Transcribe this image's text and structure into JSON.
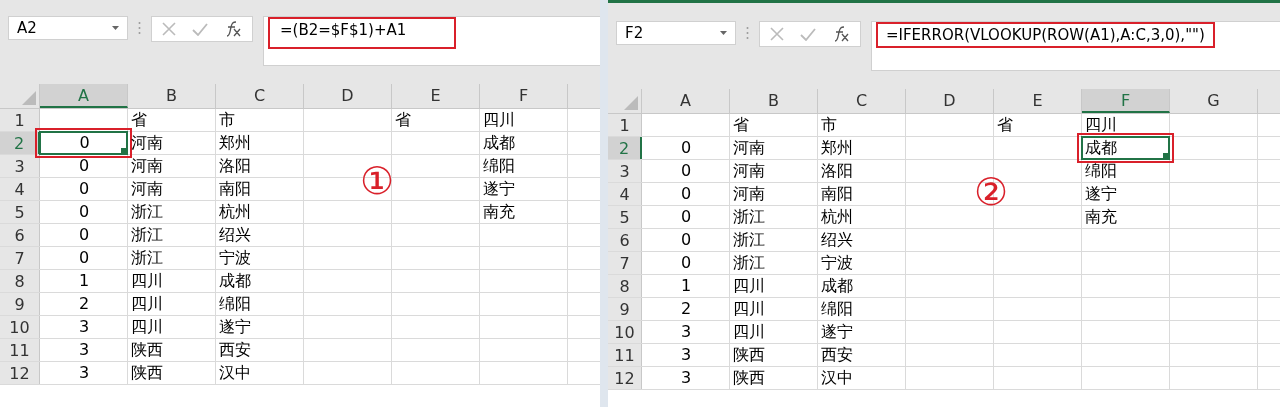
{
  "panels": [
    {
      "name_box": "A2",
      "formula": "=(B2=$F$1)+A1",
      "formula_highlighted": true,
      "cell_highlighted": true,
      "annotation": "①",
      "columns": [
        {
          "label": "A",
          "selected": true
        },
        {
          "label": "B",
          "selected": false
        },
        {
          "label": "C",
          "selected": false
        },
        {
          "label": "D",
          "selected": false
        },
        {
          "label": "E",
          "selected": false
        },
        {
          "label": "F",
          "selected": false
        }
      ],
      "rows": [
        {
          "number": "1",
          "selected": false,
          "cells": [
            "",
            "省",
            "市",
            "",
            "省",
            "四川"
          ]
        },
        {
          "number": "2",
          "selected": true,
          "cells": [
            "0",
            "河南",
            "郑州",
            "",
            "",
            "成都"
          ]
        },
        {
          "number": "3",
          "selected": false,
          "cells": [
            "0",
            "河南",
            "洛阳",
            "",
            "",
            "绵阳"
          ]
        },
        {
          "number": "4",
          "selected": false,
          "cells": [
            "0",
            "河南",
            "南阳",
            "",
            "",
            "遂宁"
          ]
        },
        {
          "number": "5",
          "selected": false,
          "cells": [
            "0",
            "浙江",
            "杭州",
            "",
            "",
            "南充"
          ]
        },
        {
          "number": "6",
          "selected": false,
          "cells": [
            "0",
            "浙江",
            "绍兴"
          ]
        },
        {
          "number": "7",
          "selected": false,
          "cells": [
            "0",
            "浙江",
            "宁波"
          ]
        },
        {
          "number": "8",
          "selected": false,
          "cells": [
            "1",
            "四川",
            "成都"
          ]
        },
        {
          "number": "9",
          "selected": false,
          "cells": [
            "2",
            "四川",
            "绵阳"
          ]
        },
        {
          "number": "10",
          "selected": false,
          "cells": [
            "3",
            "四川",
            "遂宁"
          ]
        },
        {
          "number": "11",
          "selected": false,
          "cells": [
            "3",
            "陕西",
            "西安"
          ]
        },
        {
          "number": "12",
          "selected": false,
          "cells": [
            "3",
            "陕西",
            "汉中"
          ]
        }
      ]
    },
    {
      "name_box": "F2",
      "formula": "=IFERROR(VLOOKUP(ROW(A1),A:C,3,0),\"\")",
      "formula_highlighted": true,
      "cell_highlighted": true,
      "annotation": "②",
      "columns": [
        {
          "label": "A",
          "selected": false
        },
        {
          "label": "B",
          "selected": false
        },
        {
          "label": "C",
          "selected": false
        },
        {
          "label": "D",
          "selected": false
        },
        {
          "label": "E",
          "selected": false
        },
        {
          "label": "F",
          "selected": true
        },
        {
          "label": "G",
          "selected": false
        }
      ],
      "rows": [
        {
          "number": "1",
          "selected": false,
          "cells": [
            "",
            "省",
            "市",
            "",
            "省",
            "四川"
          ]
        },
        {
          "number": "2",
          "selected": true,
          "cells": [
            "0",
            "河南",
            "郑州",
            "",
            "",
            "成都"
          ]
        },
        {
          "number": "3",
          "selected": false,
          "cells": [
            "0",
            "河南",
            "洛阳",
            "",
            "",
            "绵阳"
          ]
        },
        {
          "number": "4",
          "selected": false,
          "cells": [
            "0",
            "河南",
            "南阳",
            "",
            "",
            "遂宁"
          ]
        },
        {
          "number": "5",
          "selected": false,
          "cells": [
            "0",
            "浙江",
            "杭州",
            "",
            "",
            "南充"
          ]
        },
        {
          "number": "6",
          "selected": false,
          "cells": [
            "0",
            "浙江",
            "绍兴"
          ]
        },
        {
          "number": "7",
          "selected": false,
          "cells": [
            "0",
            "浙江",
            "宁波"
          ]
        },
        {
          "number": "8",
          "selected": false,
          "cells": [
            "1",
            "四川",
            "成都"
          ]
        },
        {
          "number": "9",
          "selected": false,
          "cells": [
            "2",
            "四川",
            "绵阳"
          ]
        },
        {
          "number": "10",
          "selected": false,
          "cells": [
            "3",
            "四川",
            "遂宁"
          ]
        },
        {
          "number": "11",
          "selected": false,
          "cells": [
            "3",
            "陕西",
            "西安"
          ]
        },
        {
          "number": "12",
          "selected": false,
          "cells": [
            "3",
            "陕西",
            "汉中"
          ]
        }
      ]
    }
  ]
}
